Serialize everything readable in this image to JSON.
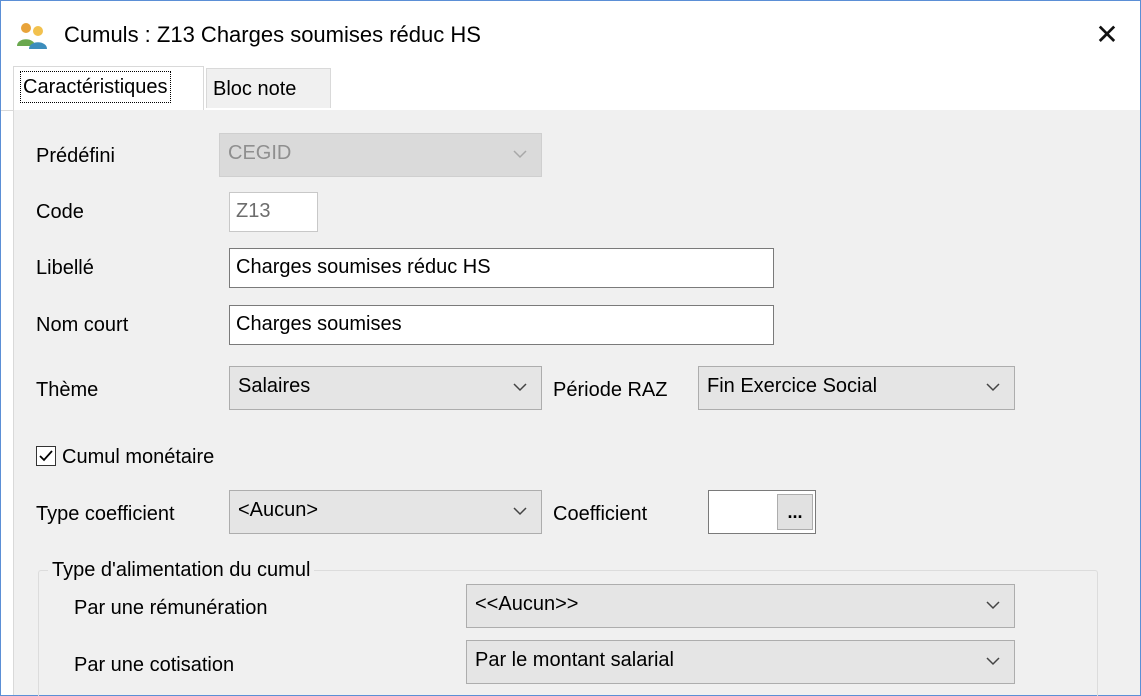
{
  "window": {
    "title": "Cumuls   : Z13 Charges soumises réduc HS",
    "icon": "users-icon",
    "close_glyph": "✕"
  },
  "tabs": [
    {
      "label": "Caractéristiques",
      "active": true
    },
    {
      "label": "Bloc note",
      "active": false
    }
  ],
  "form": {
    "predefini": {
      "label": "Prédéfini",
      "value": "CEGID"
    },
    "code": {
      "label": "Code",
      "value": "Z13"
    },
    "libelle": {
      "label": "Libellé",
      "value": "Charges soumises réduc HS"
    },
    "nom_court": {
      "label": "Nom court",
      "value": "Charges soumises"
    },
    "theme": {
      "label": "Thème",
      "value": "Salaires"
    },
    "periode_raz": {
      "label": "Période RAZ",
      "value": "Fin Exercice Social"
    },
    "cumul_monetaire": {
      "label": "Cumul monétaire",
      "checked": true
    },
    "type_coefficient": {
      "label": "Type coefficient",
      "value": "<Aucun>"
    },
    "coefficient": {
      "label": "Coefficient",
      "value": "",
      "button": "..."
    }
  },
  "alimentation": {
    "legend": "Type d'alimentation du cumul",
    "remuneration": {
      "label": "Par une rémunération",
      "value": "<<Aucun>>"
    },
    "cotisation": {
      "label": "Par une cotisation",
      "value": "Par le montant salarial"
    }
  },
  "colors": {
    "border_accent": "#5b8fd6",
    "panel_bg": "#f0f0f0",
    "combo_bg": "#e5e5e5"
  }
}
